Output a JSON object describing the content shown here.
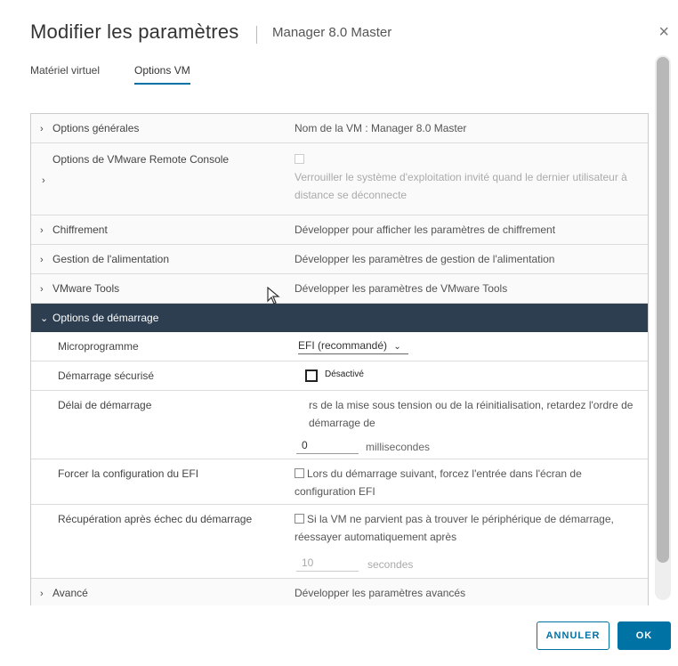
{
  "dialog": {
    "title": "Modifier les paramètres",
    "subtitle": "Manager 8.0 Master",
    "close_symbol": "×"
  },
  "tabs": [
    {
      "label": "Matériel virtuel",
      "active": false
    },
    {
      "label": "Options VM",
      "active": true
    }
  ],
  "rows": {
    "general": {
      "label": "Options générales",
      "value": "Nom de la VM : Manager 8.0 Master"
    },
    "remote_console": {
      "label": "Options de VMware Remote Console",
      "value": "Verrouiller le système d'exploitation invité quand le dernier utilisateur à distance se déconnecte"
    },
    "encryption": {
      "label": "Chiffrement",
      "value": "Développer pour afficher les paramètres de chiffrement"
    },
    "power": {
      "label": "Gestion de l'alimentation",
      "value": "Développer les paramètres de gestion de l'alimentation"
    },
    "vmware_tools": {
      "label": "VMware Tools",
      "value": "Développer les paramètres de VMware Tools"
    },
    "boot_options": {
      "label": "Options de démarrage"
    },
    "firmware": {
      "label": "Microprogramme",
      "value": "EFI (recommandé)"
    },
    "secure_boot": {
      "label": "Démarrage sécurisé",
      "value": "Désactivé"
    },
    "boot_delay": {
      "label": "Délai de démarrage",
      "value": "rs de la mise sous tension ou de la réinitialisation, retardez l'ordre de démarrage de",
      "input_value": "0",
      "unit": "millisecondes"
    },
    "force_efi": {
      "label": "Forcer la configuration du EFI",
      "value": "Lors du démarrage suivant, forcez l'entrée dans l'écran de configuration EFI"
    },
    "boot_recovery": {
      "label": "Récupération après échec du démarrage",
      "value": "Si la VM ne parvient pas à trouver le périphérique de démarrage, réessayer automatiquement après",
      "input_value": "10",
      "unit": "secondes"
    },
    "advanced": {
      "label": "Avancé",
      "value": "Développer les paramètres avancés"
    }
  },
  "icons": {
    "chevron_right": "›",
    "chevron_down": "⌄",
    "select_arrow": "⌄"
  },
  "buttons": {
    "cancel": "ANNULER",
    "ok": "OK"
  },
  "colors": {
    "accent": "#0072a3",
    "active_row": "#2c3e50"
  }
}
